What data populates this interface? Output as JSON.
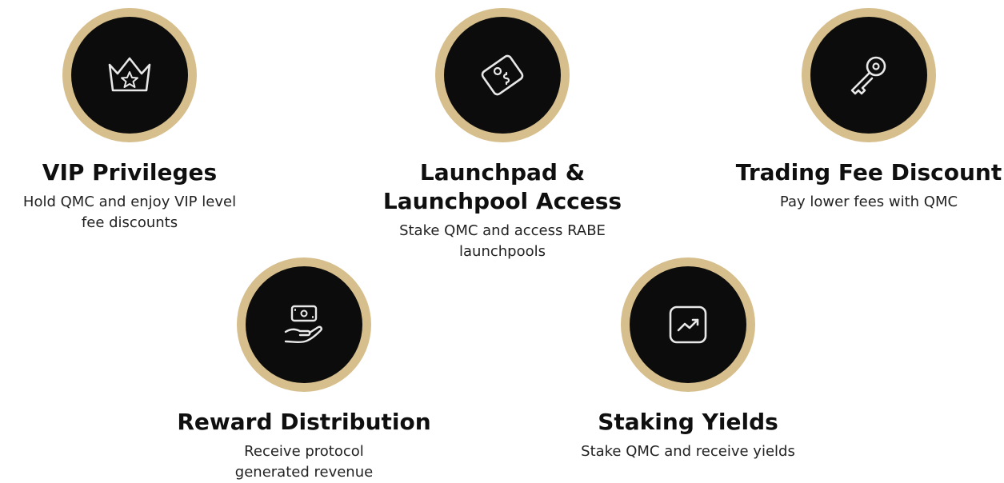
{
  "features": [
    {
      "title": "VIP Privileges",
      "description_lines": [
        "Hold QMC and enjoy VIP level",
        "fee discounts"
      ],
      "icon": "crown-icon"
    },
    {
      "title_lines": [
        "Launchpad &",
        "Launchpool Access"
      ],
      "description_lines": [
        "Stake QMC and access RABE",
        "launchpools"
      ],
      "icon": "ticket-tag-icon"
    },
    {
      "title": "Trading Fee Discount",
      "description_lines": [
        "Pay lower fees with QMC"
      ],
      "icon": "key-icon"
    },
    {
      "title": "Reward Distribution",
      "description_lines": [
        "Receive protocol",
        "generated revenue"
      ],
      "icon": "hand-money-icon"
    },
    {
      "title": "Staking Yields",
      "description_lines": [
        "Stake QMC and receive yields"
      ],
      "icon": "trending-chart-icon"
    }
  ],
  "colors": {
    "ring": "#d6bf8d",
    "disc": "#0c0c0c",
    "icon_stroke": "#e8e8e8"
  }
}
